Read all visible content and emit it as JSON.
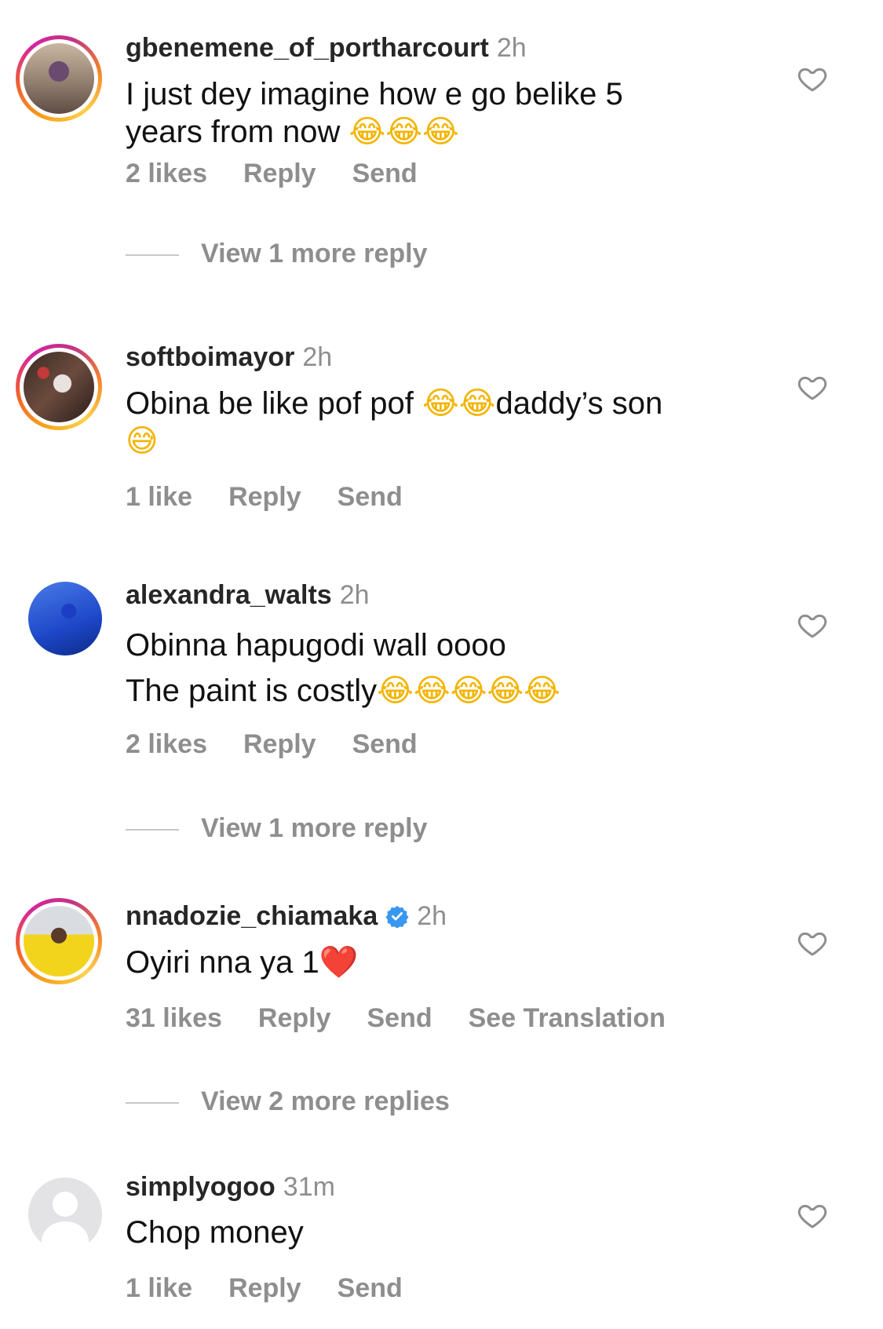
{
  "comments": [
    {
      "username": "gbenemene_of_portharcourt",
      "time": "2h",
      "text_line1": "I just dey imagine how e go belike 5",
      "text_line2": "years from now ",
      "emojis_line2": "😂😂😂",
      "likes": "2 likes",
      "reply": "Reply",
      "send": "Send",
      "view_replies": "View 1 more reply",
      "verified": false
    },
    {
      "username": "softboimayor",
      "time": "2h",
      "text_line1": "Obina be like pof pof ",
      "emojis_mid": "😂😂",
      "text_line1_end": "daddy’s son",
      "emojis_line2": "😅",
      "likes": "1 like",
      "reply": "Reply",
      "send": "Send",
      "verified": false
    },
    {
      "username": "alexandra_walts",
      "time": "2h",
      "text_line1": "Obinna hapugodi wall oooo",
      "text_line2": "The paint is costly",
      "emojis_line2": "😂😂😂😂😂",
      "likes": "2 likes",
      "reply": "Reply",
      "send": "Send",
      "view_replies": "View 1 more reply",
      "verified": false
    },
    {
      "username": "nnadozie_chiamaka",
      "time": "2h",
      "text_line1": "Oyiri nna ya 1",
      "emojis_line1": "❤️",
      "likes": "31 likes",
      "reply": "Reply",
      "send": "Send",
      "see_translation": "See Translation",
      "view_replies": "View 2 more replies",
      "verified": true
    },
    {
      "username": "simplyogoo",
      "time": "31m",
      "text_line1": "Chop money",
      "likes": "1 like",
      "reply": "Reply",
      "send": "Send",
      "verified": false
    }
  ],
  "icons": {
    "like": "heart-outline-icon",
    "verified": "verified-badge-icon",
    "default_avatar": "default-avatar-icon"
  },
  "colors": {
    "secondary_text": "#8e8e8e",
    "verified_blue": "#3897f0",
    "story_ring": "#d6249f"
  }
}
